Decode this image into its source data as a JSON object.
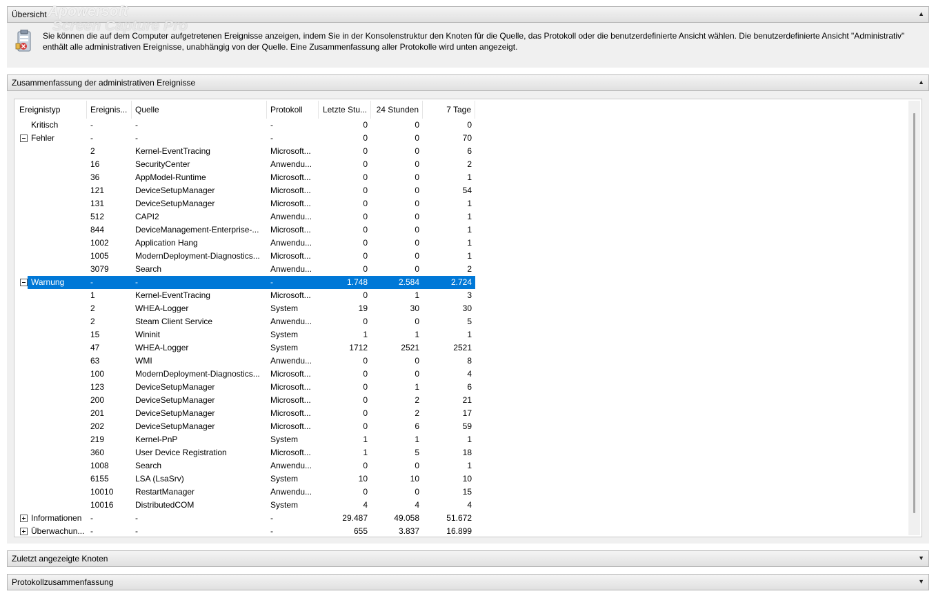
{
  "watermark": {
    "line1": "Apowersoft",
    "line2": "Screen Capture Pro"
  },
  "overview": {
    "header": "Übersicht",
    "text": "Sie können die auf dem Computer aufgetretenen Ereignisse anzeigen, indem Sie in der Konsolenstruktur den Knoten für die Quelle, das Protokoll oder die benutzerdefinierte Ansicht wählen. Die benutzerdefinierte Ansicht \"Administrativ\" enthält alle administrativen Ereignisse, unabhängig von der Quelle. Eine Zusammenfassung aller Protokolle wird unten angezeigt."
  },
  "summary": {
    "header": "Zusammenfassung der administrativen Ereignisse",
    "columns": [
      "Ereignistyp",
      "Ereignis...",
      "Quelle",
      "Protokoll",
      "Letzte Stu...",
      "24 Stunden",
      "7 Tage"
    ],
    "rows": [
      {
        "type": "Kritisch",
        "id": "-",
        "source": "-",
        "log": "-",
        "hour": "0",
        "day": "0",
        "week": "0",
        "level": "group",
        "expander": ""
      },
      {
        "type": "Fehler",
        "id": "-",
        "source": "-",
        "log": "-",
        "hour": "0",
        "day": "0",
        "week": "70",
        "level": "group",
        "expander": "minus"
      },
      {
        "type": "",
        "id": "2",
        "source": "Kernel-EventTracing",
        "log": "Microsoft...",
        "hour": "0",
        "day": "0",
        "week": "6",
        "level": "child",
        "expander": ""
      },
      {
        "type": "",
        "id": "16",
        "source": "SecurityCenter",
        "log": "Anwendu...",
        "hour": "0",
        "day": "0",
        "week": "2",
        "level": "child",
        "expander": ""
      },
      {
        "type": "",
        "id": "36",
        "source": "AppModel-Runtime",
        "log": "Microsoft...",
        "hour": "0",
        "day": "0",
        "week": "1",
        "level": "child",
        "expander": ""
      },
      {
        "type": "",
        "id": "121",
        "source": "DeviceSetupManager",
        "log": "Microsoft...",
        "hour": "0",
        "day": "0",
        "week": "54",
        "level": "child",
        "expander": ""
      },
      {
        "type": "",
        "id": "131",
        "source": "DeviceSetupManager",
        "log": "Microsoft...",
        "hour": "0",
        "day": "0",
        "week": "1",
        "level": "child",
        "expander": ""
      },
      {
        "type": "",
        "id": "512",
        "source": "CAPI2",
        "log": "Anwendu...",
        "hour": "0",
        "day": "0",
        "week": "1",
        "level": "child",
        "expander": ""
      },
      {
        "type": "",
        "id": "844",
        "source": "DeviceManagement-Enterprise-...",
        "log": "Microsoft...",
        "hour": "0",
        "day": "0",
        "week": "1",
        "level": "child",
        "expander": ""
      },
      {
        "type": "",
        "id": "1002",
        "source": "Application Hang",
        "log": "Anwendu...",
        "hour": "0",
        "day": "0",
        "week": "1",
        "level": "child",
        "expander": ""
      },
      {
        "type": "",
        "id": "1005",
        "source": "ModernDeployment-Diagnostics...",
        "log": "Microsoft...",
        "hour": "0",
        "day": "0",
        "week": "1",
        "level": "child",
        "expander": ""
      },
      {
        "type": "",
        "id": "3079",
        "source": "Search",
        "log": "Anwendu...",
        "hour": "0",
        "day": "0",
        "week": "2",
        "level": "child",
        "expander": ""
      },
      {
        "type": "Warnung",
        "id": "-",
        "source": "-",
        "log": "-",
        "hour": "1.748",
        "day": "2.584",
        "week": "2.724",
        "level": "group",
        "expander": "minus",
        "selected": true
      },
      {
        "type": "",
        "id": "1",
        "source": "Kernel-EventTracing",
        "log": "Microsoft...",
        "hour": "0",
        "day": "1",
        "week": "3",
        "level": "child",
        "expander": ""
      },
      {
        "type": "",
        "id": "2",
        "source": "WHEA-Logger",
        "log": "System",
        "hour": "19",
        "day": "30",
        "week": "30",
        "level": "child",
        "expander": ""
      },
      {
        "type": "",
        "id": "2",
        "source": "Steam Client Service",
        "log": "Anwendu...",
        "hour": "0",
        "day": "0",
        "week": "5",
        "level": "child",
        "expander": ""
      },
      {
        "type": "",
        "id": "15",
        "source": "Wininit",
        "log": "System",
        "hour": "1",
        "day": "1",
        "week": "1",
        "level": "child",
        "expander": ""
      },
      {
        "type": "",
        "id": "47",
        "source": "WHEA-Logger",
        "log": "System",
        "hour": "1712",
        "day": "2521",
        "week": "2521",
        "level": "child",
        "expander": ""
      },
      {
        "type": "",
        "id": "63",
        "source": "WMI",
        "log": "Anwendu...",
        "hour": "0",
        "day": "0",
        "week": "8",
        "level": "child",
        "expander": ""
      },
      {
        "type": "",
        "id": "100",
        "source": "ModernDeployment-Diagnostics...",
        "log": "Microsoft...",
        "hour": "0",
        "day": "0",
        "week": "4",
        "level": "child",
        "expander": ""
      },
      {
        "type": "",
        "id": "123",
        "source": "DeviceSetupManager",
        "log": "Microsoft...",
        "hour": "0",
        "day": "1",
        "week": "6",
        "level": "child",
        "expander": ""
      },
      {
        "type": "",
        "id": "200",
        "source": "DeviceSetupManager",
        "log": "Microsoft...",
        "hour": "0",
        "day": "2",
        "week": "21",
        "level": "child",
        "expander": ""
      },
      {
        "type": "",
        "id": "201",
        "source": "DeviceSetupManager",
        "log": "Microsoft...",
        "hour": "0",
        "day": "2",
        "week": "17",
        "level": "child",
        "expander": ""
      },
      {
        "type": "",
        "id": "202",
        "source": "DeviceSetupManager",
        "log": "Microsoft...",
        "hour": "0",
        "day": "6",
        "week": "59",
        "level": "child",
        "expander": ""
      },
      {
        "type": "",
        "id": "219",
        "source": "Kernel-PnP",
        "log": "System",
        "hour": "1",
        "day": "1",
        "week": "1",
        "level": "child",
        "expander": ""
      },
      {
        "type": "",
        "id": "360",
        "source": "User Device Registration",
        "log": "Microsoft...",
        "hour": "1",
        "day": "5",
        "week": "18",
        "level": "child",
        "expander": ""
      },
      {
        "type": "",
        "id": "1008",
        "source": "Search",
        "log": "Anwendu...",
        "hour": "0",
        "day": "0",
        "week": "1",
        "level": "child",
        "expander": ""
      },
      {
        "type": "",
        "id": "6155",
        "source": "LSA (LsaSrv)",
        "log": "System",
        "hour": "10",
        "day": "10",
        "week": "10",
        "level": "child",
        "expander": ""
      },
      {
        "type": "",
        "id": "10010",
        "source": "RestartManager",
        "log": "Anwendu...",
        "hour": "0",
        "day": "0",
        "week": "15",
        "level": "child",
        "expander": ""
      },
      {
        "type": "",
        "id": "10016",
        "source": "DistributedCOM",
        "log": "System",
        "hour": "4",
        "day": "4",
        "week": "4",
        "level": "child",
        "expander": ""
      },
      {
        "type": "Informationen",
        "id": "-",
        "source": "-",
        "log": "-",
        "hour": "29.487",
        "day": "49.058",
        "week": "51.672",
        "level": "group",
        "expander": "plus"
      },
      {
        "type": "Überwachun...",
        "id": "-",
        "source": "-",
        "log": "-",
        "hour": "655",
        "day": "3.837",
        "week": "16.899",
        "level": "group",
        "expander": "plus"
      }
    ]
  },
  "recent_nodes": {
    "header": "Zuletzt angezeigte Knoten"
  },
  "log_summary": {
    "header": "Protokollzusammenfassung"
  },
  "icons": {
    "collapse": "chevron-up-icon",
    "expand": "chevron-down-icon",
    "overview": "event-viewer-icon"
  },
  "colors": {
    "selection": "#0078d7",
    "header_bg": "#e6e6e6",
    "panel_bg": "#f0f0f0"
  }
}
